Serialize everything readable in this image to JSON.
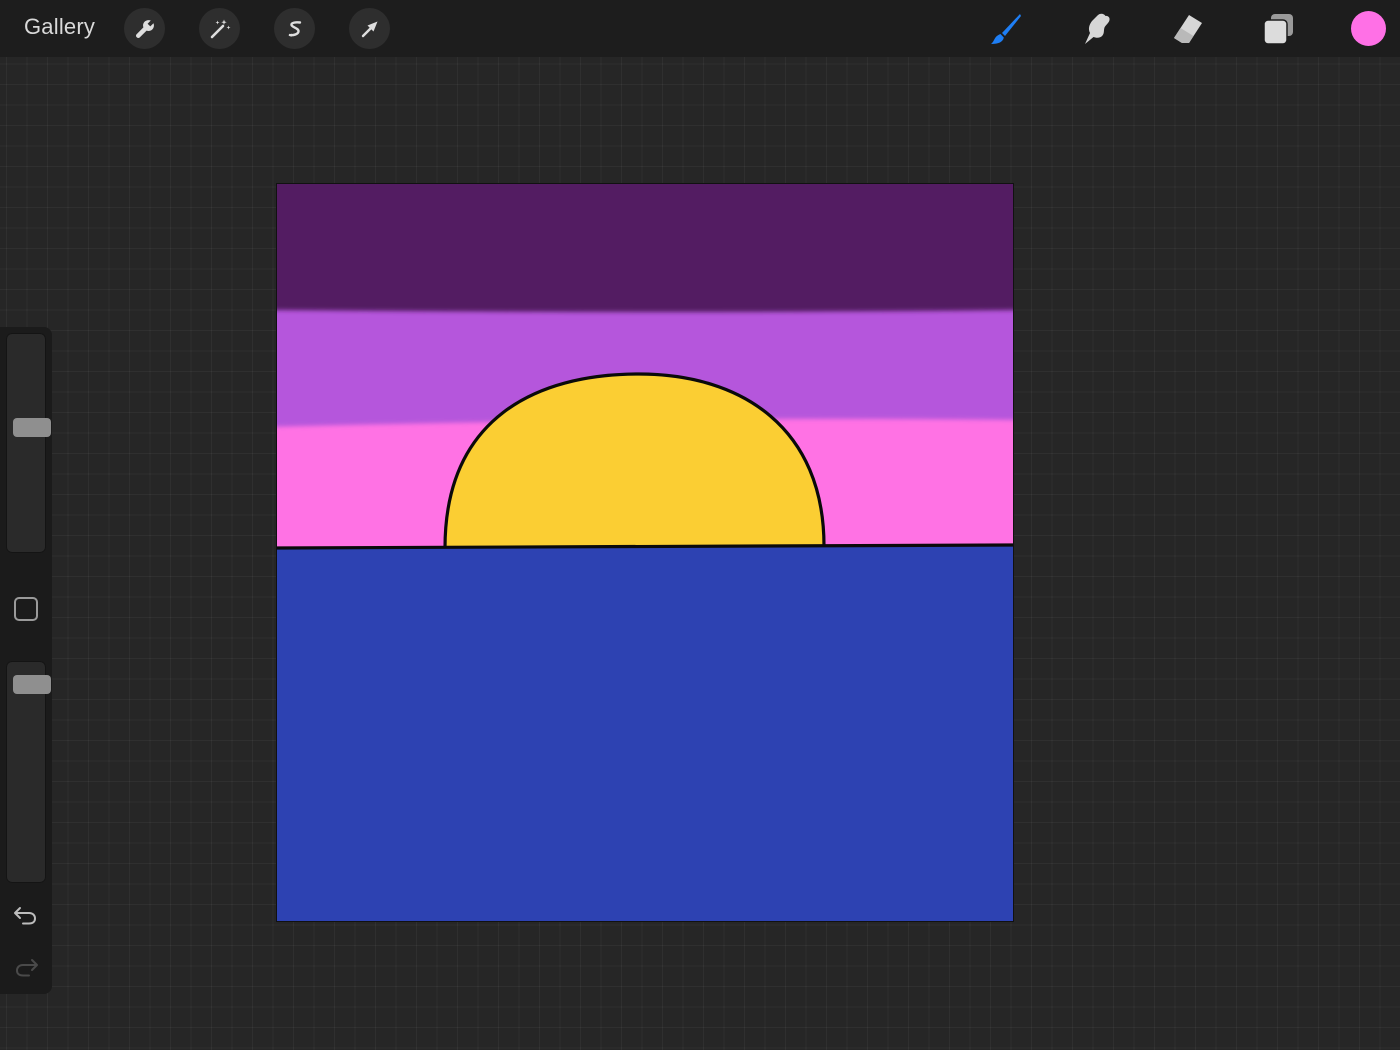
{
  "header": {
    "gallery_label": "Gallery",
    "left_tools": [
      {
        "name": "actions",
        "icon": "wrench-icon"
      },
      {
        "name": "adjustments",
        "icon": "magic-wand-icon"
      },
      {
        "name": "selection",
        "icon": "selection-s-icon"
      },
      {
        "name": "transform",
        "icon": "arrow-cursor-icon"
      }
    ],
    "right_tools": [
      {
        "name": "brush",
        "icon": "brush-icon",
        "active": true
      },
      {
        "name": "smudge",
        "icon": "smudge-finger-icon"
      },
      {
        "name": "eraser",
        "icon": "eraser-icon"
      },
      {
        "name": "layers",
        "icon": "layers-icon"
      }
    ],
    "current_color": "#ff70e6"
  },
  "sidebar": {
    "brush_size_level": 0.58,
    "opacity_level": 0.94,
    "controls": [
      "brush-size-slider",
      "modify-button",
      "opacity-slider",
      "undo-icon",
      "redo-icon"
    ]
  },
  "artwork": {
    "colors": {
      "top_band": "#521e62",
      "middle_band": "#b556dc",
      "lower_band": "#ff72e4",
      "sun": "#fbce33",
      "sea": "#2d42b2",
      "outline": "#0a0a0a"
    }
  }
}
